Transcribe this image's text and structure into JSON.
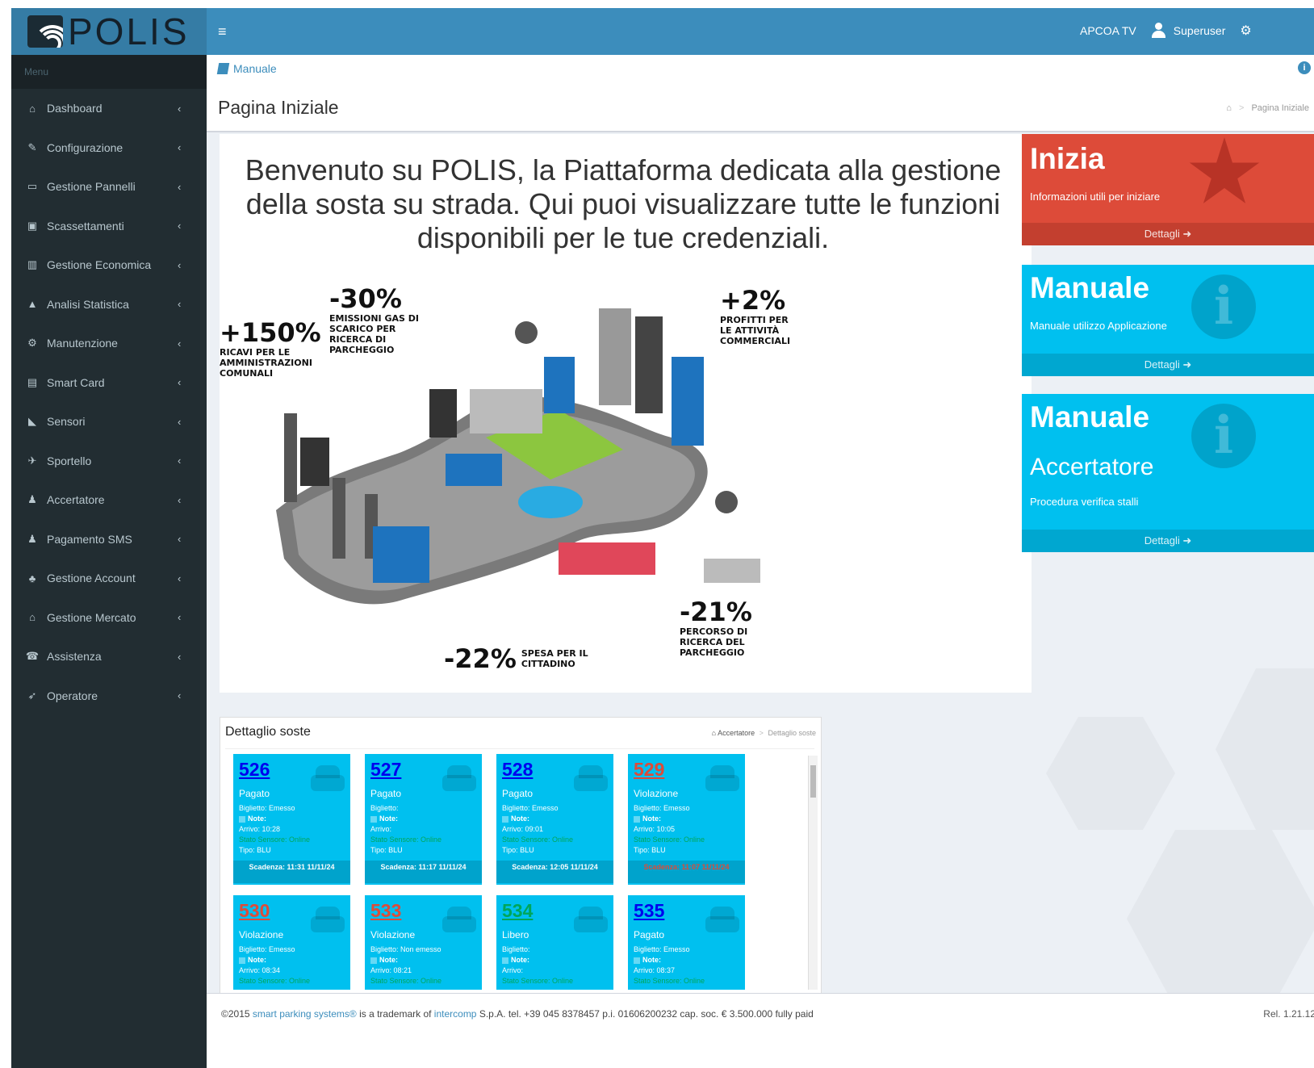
{
  "app": {
    "logo_text": "POLIS",
    "menu_header": "Menu"
  },
  "header": {
    "toggle_icon": "hamburger-icon",
    "account": "APCOA TV",
    "user": "Superuser"
  },
  "sidebar": {
    "items": [
      {
        "label": "Dashboard",
        "icon": "dashboard-icon",
        "glyph": "⌂"
      },
      {
        "label": "Configurazione",
        "icon": "wrench-icon",
        "glyph": "✎"
      },
      {
        "label": "Gestione Pannelli",
        "icon": "monitor-icon",
        "glyph": "▭"
      },
      {
        "label": "Scassettamenti",
        "icon": "money-icon",
        "glyph": "▣"
      },
      {
        "label": "Gestione Economica",
        "icon": "chart-icon",
        "glyph": "▥"
      },
      {
        "label": "Analisi Statistica",
        "icon": "area-chart-icon",
        "glyph": "▲"
      },
      {
        "label": "Manutenzione",
        "icon": "gear-icon",
        "glyph": "⚙"
      },
      {
        "label": "Smart Card",
        "icon": "card-icon",
        "glyph": "▤"
      },
      {
        "label": "Sensori",
        "icon": "rss-icon",
        "glyph": "◣"
      },
      {
        "label": "Sportello",
        "icon": "plane-icon",
        "glyph": "✈"
      },
      {
        "label": "Accertatore",
        "icon": "user-icon",
        "glyph": "♟"
      },
      {
        "label": "Pagamento SMS",
        "icon": "sms-icon",
        "glyph": "♟"
      },
      {
        "label": "Gestione Account",
        "icon": "users-icon",
        "glyph": "♣"
      },
      {
        "label": "Gestione Mercato",
        "icon": "shop-icon",
        "glyph": "⌂"
      },
      {
        "label": "Assistenza",
        "icon": "support-icon",
        "glyph": "☎"
      },
      {
        "label": "Operatore",
        "icon": "rocket-icon",
        "glyph": "➶"
      }
    ]
  },
  "subbar": {
    "label": "Manuale"
  },
  "page": {
    "title": "Pagina Iniziale",
    "breadcrumb": "Pagina Iniziale"
  },
  "welcome": {
    "text": "Benvenuto su POLIS, la Piattaforma dedicata alla gestione della sosta su strada. Qui puoi visualizzare tutte le funzioni disponibili per le tue credenziali."
  },
  "infographic": {
    "stats": [
      {
        "big": "+150%",
        "small": "RICAVI PER LE AMMINISTRAZIONI COMUNALI"
      },
      {
        "big": "-30%",
        "small": "EMISSIONI GAS DI SCARICO PER RICERCA DI PARCHEGGIO"
      },
      {
        "big": "+2%",
        "small": "PROFITTI PER LE ATTIVITÀ COMMERCIALI"
      },
      {
        "big": "-21%",
        "small": "PERCORSO DI RICERCA DEL PARCHEGGIO"
      },
      {
        "big": "-22%",
        "small": "SPESA PER IL CITTADINO"
      }
    ]
  },
  "tiles": [
    {
      "title": "Inizia",
      "desc": "Informazioni utili per iniziare",
      "footer": "Dettagli ➜",
      "color": "#dd4b39",
      "icon": "star-icon"
    },
    {
      "title": "Manuale",
      "desc": "Manuale utilizzo Applicazione",
      "footer": "Dettagli ➜",
      "color": "#00c0ef",
      "icon": "info-icon"
    },
    {
      "title": "Manuale",
      "subtitle": "Accertatore",
      "desc": "Procedura verifica stalli",
      "footer": "Dettagli ➜",
      "color": "#00c0ef",
      "icon": "info-icon"
    }
  ],
  "detail": {
    "title": "Dettaglio soste",
    "crumb_home": "Accertatore",
    "crumb_current": "Dettaglio soste",
    "cards": [
      {
        "num": "526",
        "num_color": "#0000ee",
        "status": "Pagato",
        "biglietto": "Biglietto: Emesso",
        "note": "Note:",
        "arrivo": "Arrivo: 10:28",
        "sensore": "Stato Sensore: Online",
        "tipo": "Tipo: BLU",
        "scadenza": "Scadenza: 11:31 11/11/24",
        "scad_color": "#ffffff"
      },
      {
        "num": "527",
        "num_color": "#0000ee",
        "status": "Pagato",
        "biglietto": "Biglietto:",
        "note": "Note:",
        "arrivo": "Arrivo:",
        "sensore": "Stato Sensore: Online",
        "tipo": "Tipo: BLU",
        "scadenza": "Scadenza: 11:17 11/11/24",
        "scad_color": "#ffffff"
      },
      {
        "num": "528",
        "num_color": "#0000ee",
        "status": "Pagato",
        "biglietto": "Biglietto: Emesso",
        "note": "Note:",
        "arrivo": "Arrivo: 09:01",
        "sensore": "Stato Sensore: Online",
        "tipo": "Tipo: BLU",
        "scadenza": "Scadenza: 12:05 11/11/24",
        "scad_color": "#ffffff"
      },
      {
        "num": "529",
        "num_color": "#dd4b39",
        "status": "Violazione",
        "biglietto": "Biglietto: Emesso",
        "note": "Note:",
        "arrivo": "Arrivo: 10:05",
        "sensore": "Stato Sensore: Online",
        "tipo": "Tipo: BLU",
        "scadenza": "Scadenza: 11:07 11/11/24",
        "scad_color": "#dd4b39"
      },
      {
        "num": "530",
        "num_color": "#dd4b39",
        "status": "Violazione",
        "biglietto": "Biglietto: Emesso",
        "note": "Note:",
        "arrivo": "Arrivo: 08:34",
        "sensore": "Stato Sensore: Online"
      },
      {
        "num": "533",
        "num_color": "#dd4b39",
        "status": "Violazione",
        "biglietto": "Biglietto: Non emesso",
        "note": "Note:",
        "arrivo": "Arrivo: 08:21",
        "sensore": "Stato Sensore: Online"
      },
      {
        "num": "534",
        "num_color": "#00a65a",
        "status": "Libero",
        "biglietto": "Biglietto:",
        "note": "Note:",
        "arrivo": "Arrivo:",
        "sensore": "Stato Sensore: Online"
      },
      {
        "num": "535",
        "num_color": "#0000ee",
        "status": "Pagato",
        "biglietto": "Biglietto: Emesso",
        "note": "Note:",
        "arrivo": "Arrivo: 08:37",
        "sensore": "Stato Sensore: Online"
      }
    ]
  },
  "footer": {
    "pre": "©2015 ",
    "link1": "smart parking systems®",
    "mid": " is a trademark of ",
    "link2": "intercomp",
    "post": " S.p.A. tel. +39 045 8378457 p.i. 01606200232 cap. soc. € 3.500.000 fully paid",
    "version": "Rel. 1.21.12"
  }
}
